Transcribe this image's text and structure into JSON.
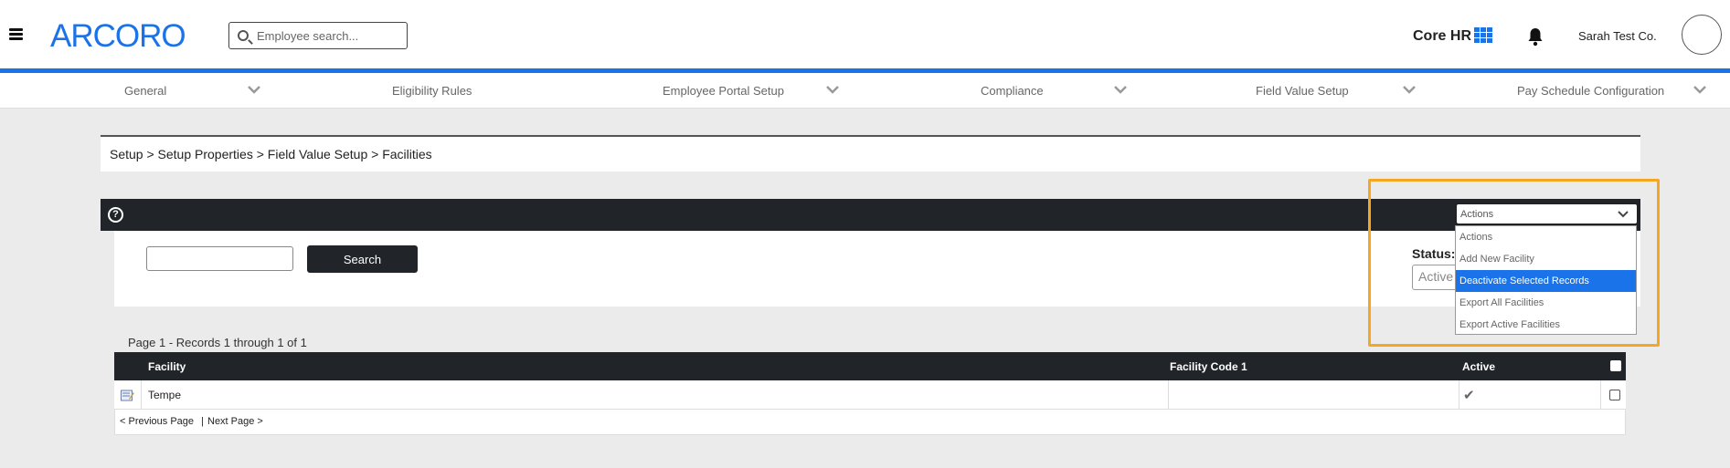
{
  "header": {
    "logo": "ARCORO",
    "search_placeholder": "Employee search...",
    "product": "Core HR",
    "company": "Sarah Test Co."
  },
  "subnav": {
    "items": [
      {
        "label": "General",
        "has_chevron": true
      },
      {
        "label": "Eligibility Rules",
        "has_chevron": false
      },
      {
        "label": "Employee Portal Setup",
        "has_chevron": true
      },
      {
        "label": "Compliance",
        "has_chevron": true
      },
      {
        "label": "Field Value Setup",
        "has_chevron": true
      },
      {
        "label": "Pay Schedule Configuration",
        "has_chevron": true
      }
    ]
  },
  "breadcrumb": "Setup > Setup Properties > Field Value Setup > Facilities",
  "search_panel": {
    "button": "Search",
    "status_label": "Status:",
    "status_value": "Active"
  },
  "actions": {
    "selected": "Actions",
    "options": [
      "Actions",
      "Add New Facility",
      "Deactivate Selected Records",
      "Export All Facilities",
      "Export Active Facilities"
    ],
    "highlighted_index": 2
  },
  "records": {
    "info": "Page 1 - Records 1 through 1 of 1",
    "columns": [
      "Facility",
      "Facility Code 1",
      "Active"
    ],
    "rows": [
      {
        "facility": "Tempe",
        "code": "",
        "active": "✔"
      }
    ],
    "pager_prev": "< Previous Page",
    "pager_sep": "|",
    "pager_next": "Next Page >"
  },
  "colors": {
    "accent": "#1a73e8",
    "dark": "#212529",
    "highlight": "#f5a623"
  }
}
